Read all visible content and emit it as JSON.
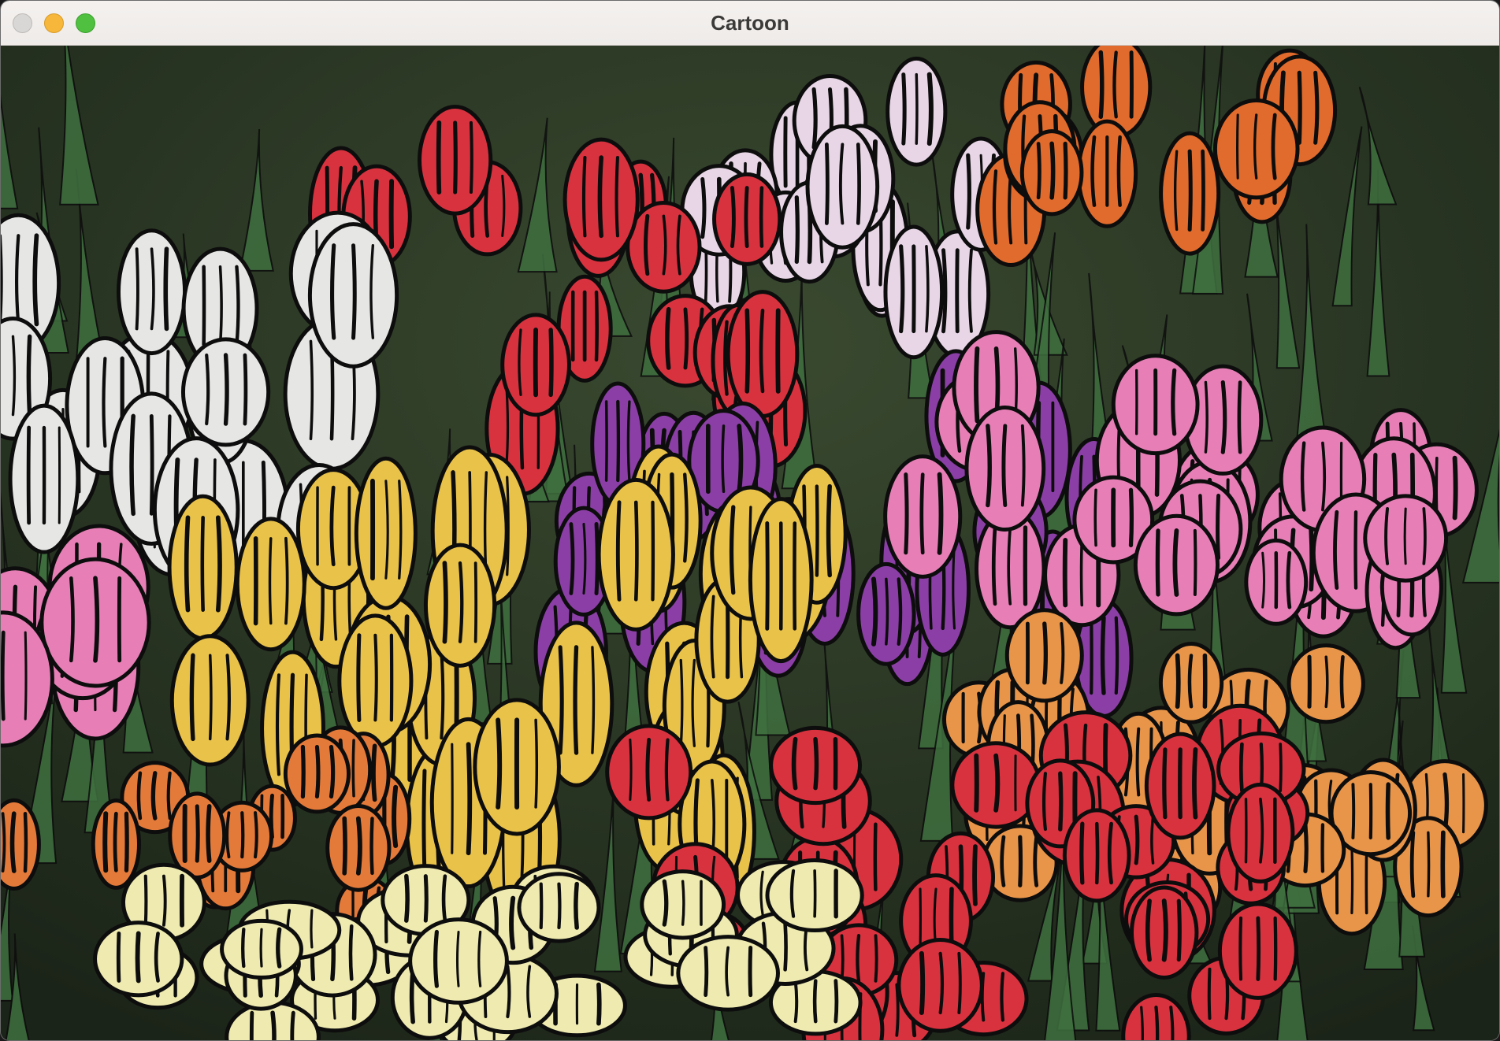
{
  "window": {
    "title": "Cartoon",
    "controls": {
      "close": "close-button",
      "minimize": "minimize-button",
      "zoom": "zoom-button"
    }
  },
  "image": {
    "description_icon": "cartoon-tulips-image",
    "colors": {
      "yellow": "#e9c24a",
      "red": "#d8323f",
      "white": "#e6e6e4",
      "pink": "#e77fb6",
      "purple": "#8b3fa6",
      "orange": "#e06b2c",
      "leaf": "#3f6f3f",
      "cream": "#eeeab0",
      "outline": "#0d0d0d"
    }
  }
}
